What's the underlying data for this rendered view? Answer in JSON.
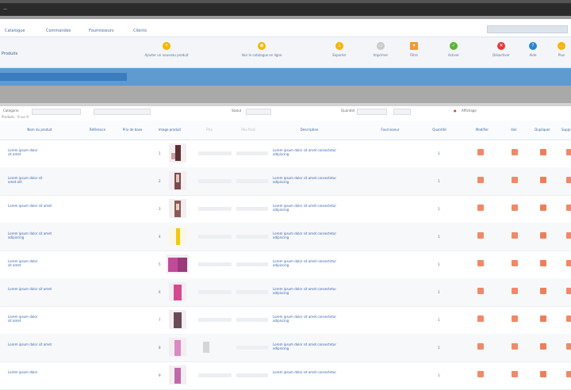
{
  "topbar": {
    "title": "—"
  },
  "menu": {
    "items": [
      "Catalogue",
      "Commandes",
      "Fournisseurs",
      "Clients"
    ]
  },
  "toolbar": {
    "left_label": "Produits",
    "buttons": [
      {
        "label": "Ajouter un nouveau produit",
        "icon": "add-icon",
        "color": "#f6b500"
      },
      {
        "label": "Voir le catalogue en ligne",
        "icon": "view-icon",
        "color": "#f6b500"
      },
      {
        "label": "Exporter",
        "icon": "export-icon",
        "color": "#f6b500"
      },
      {
        "label": "Imprimer",
        "icon": "print-icon",
        "color": "#c8c8c8"
      },
      {
        "label": "Filtre",
        "icon": "filter-icon",
        "color": "#f29a2e"
      },
      {
        "label": "Activer",
        "icon": "enable-icon",
        "color": "#5bb531"
      },
      {
        "label": "Désactiver",
        "icon": "disable-icon",
        "color": "#e23b3b"
      },
      {
        "label": "Aide",
        "icon": "help-icon",
        "color": "#2a86d1"
      },
      {
        "label": "Plus",
        "icon": "more-icon",
        "color": "#f6b500"
      }
    ]
  },
  "filters": {
    "labels": [
      "Catégorie",
      "Statut",
      "Quantité",
      "Affichage"
    ],
    "info": "Produits : 9 sur 9"
  },
  "table": {
    "headers": [
      "Nom du produit",
      "Référence",
      "Prix de base",
      "Image produit",
      "Prix",
      "Prix final",
      "Description",
      "Fournisseur",
      "Quantité",
      "Modifier",
      "Voir",
      "Dupliquer",
      "Supprimer"
    ],
    "rows": [
      {
        "name": "Lorem ipsum dolor",
        "name2": "sit amet",
        "num": "1",
        "desc": "Lorem ipsum dolor sit amet consectetur adipiscing",
        "qty": "1"
      },
      {
        "name": "Lorem ipsum dolor sit",
        "name2": "amet elit",
        "num": "2",
        "desc": "Lorem ipsum dolor sit amet consectetur adipiscing",
        "qty": "1"
      },
      {
        "name": "Lorem ipsum dolor sit amet",
        "name2": "",
        "num": "3",
        "desc": "Lorem ipsum dolor sit amet consectetur adipiscing",
        "qty": "1"
      },
      {
        "name": "Lorem ipsum dolor sit amet",
        "name2": "adipiscing",
        "num": "4",
        "desc": "Lorem ipsum dolor sit amet consectetur adipiscing",
        "qty": "1"
      },
      {
        "name": "Lorem ipsum dolor",
        "name2": "sit amet",
        "num": "5",
        "desc": "Lorem ipsum dolor sit amet consectetur adipiscing",
        "qty": "1"
      },
      {
        "name": "Lorem ipsum dolor sit amet",
        "name2": "",
        "num": "6",
        "desc": "Lorem ipsum dolor sit amet consectetur adipiscing",
        "qty": "1"
      },
      {
        "name": "Lorem ipsum dolor",
        "name2": "sit amet",
        "num": "7",
        "desc": "Lorem ipsum dolor sit amet consectetur adipiscing",
        "qty": "1"
      },
      {
        "name": "Lorem ipsum dolor sit amet",
        "name2": "",
        "num": "8",
        "desc": "Lorem ipsum dolor sit amet consectetur adipiscing",
        "qty": "1"
      },
      {
        "name": "Lorem ipsum dolor",
        "name2": "",
        "num": "9",
        "desc": "Lorem ipsum dolor sit amet consectetur",
        "qty": "1"
      }
    ]
  }
}
